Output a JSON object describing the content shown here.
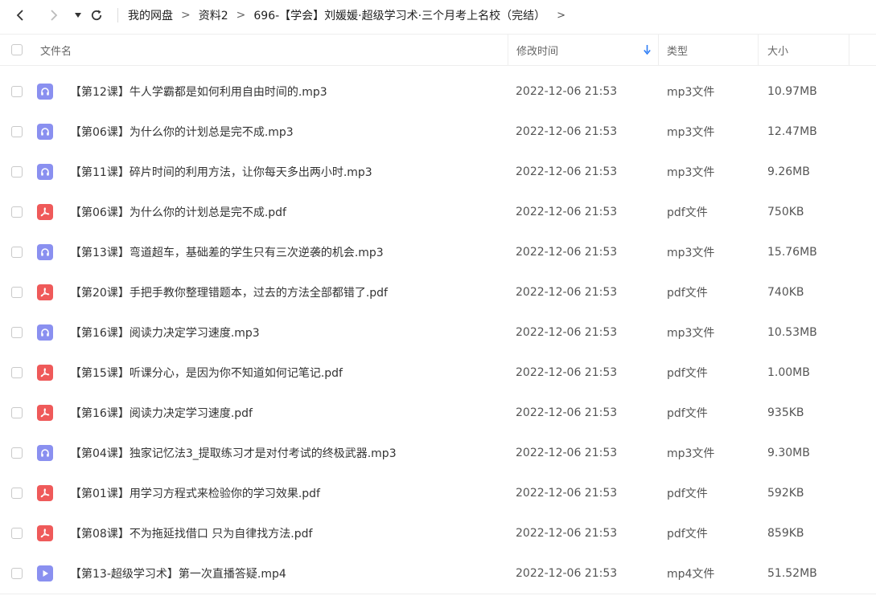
{
  "nav": {
    "breadcrumb": [
      "我的网盘",
      "资料2",
      "696-【学会】刘媛媛·超级学习术·三个月考上名校（完结）"
    ]
  },
  "columns": {
    "name": "文件名",
    "modified": "修改时间",
    "type": "类型",
    "size": "大小"
  },
  "colors": {
    "audio": "#8a90f0",
    "pdf": "#ef5a5a",
    "video": "#8a90f0",
    "sort_arrow": "#2d7df6"
  },
  "files": [
    {
      "icon": "audio",
      "name": "【第12课】牛人学霸都是如何利用自由时间的.mp3",
      "modified": "2022-12-06 21:53",
      "type": "mp3文件",
      "size": "10.97MB"
    },
    {
      "icon": "audio",
      "name": "【第06课】为什么你的计划总是完不成.mp3",
      "modified": "2022-12-06 21:53",
      "type": "mp3文件",
      "size": "12.47MB"
    },
    {
      "icon": "audio",
      "name": "【第11课】碎片时间的利用方法，让你每天多出两小时.mp3",
      "modified": "2022-12-06 21:53",
      "type": "mp3文件",
      "size": "9.26MB"
    },
    {
      "icon": "pdf",
      "name": "【第06课】为什么你的计划总是完不成.pdf",
      "modified": "2022-12-06 21:53",
      "type": "pdf文件",
      "size": "750KB"
    },
    {
      "icon": "audio",
      "name": "【第13课】弯道超车，基础差的学生只有三次逆袭的机会.mp3",
      "modified": "2022-12-06 21:53",
      "type": "mp3文件",
      "size": "15.76MB"
    },
    {
      "icon": "pdf",
      "name": "【第20课】手把手教你整理错题本，过去的方法全部都错了.pdf",
      "modified": "2022-12-06 21:53",
      "type": "pdf文件",
      "size": "740KB"
    },
    {
      "icon": "audio",
      "name": "【第16课】阅读力决定学习速度.mp3",
      "modified": "2022-12-06 21:53",
      "type": "mp3文件",
      "size": "10.53MB"
    },
    {
      "icon": "pdf",
      "name": "【第15课】听课分心，是因为你不知道如何记笔记.pdf",
      "modified": "2022-12-06 21:53",
      "type": "pdf文件",
      "size": "1.00MB"
    },
    {
      "icon": "pdf",
      "name": "【第16课】阅读力决定学习速度.pdf",
      "modified": "2022-12-06 21:53",
      "type": "pdf文件",
      "size": "935KB"
    },
    {
      "icon": "audio",
      "name": "【第04课】独家记忆法3_提取练习才是对付考试的终极武器.mp3",
      "modified": "2022-12-06 21:53",
      "type": "mp3文件",
      "size": "9.30MB"
    },
    {
      "icon": "pdf",
      "name": "【第01课】用学习方程式来检验你的学习效果.pdf",
      "modified": "2022-12-06 21:53",
      "type": "pdf文件",
      "size": "592KB"
    },
    {
      "icon": "pdf",
      "name": "【第08课】不为拖延找借口 只为自律找方法.pdf",
      "modified": "2022-12-06 21:53",
      "type": "pdf文件",
      "size": "859KB"
    },
    {
      "icon": "video",
      "name": "【第13-超级学习术】第一次直播答疑.mp4",
      "modified": "2022-12-06 21:53",
      "type": "mp4文件",
      "size": "51.52MB"
    }
  ]
}
